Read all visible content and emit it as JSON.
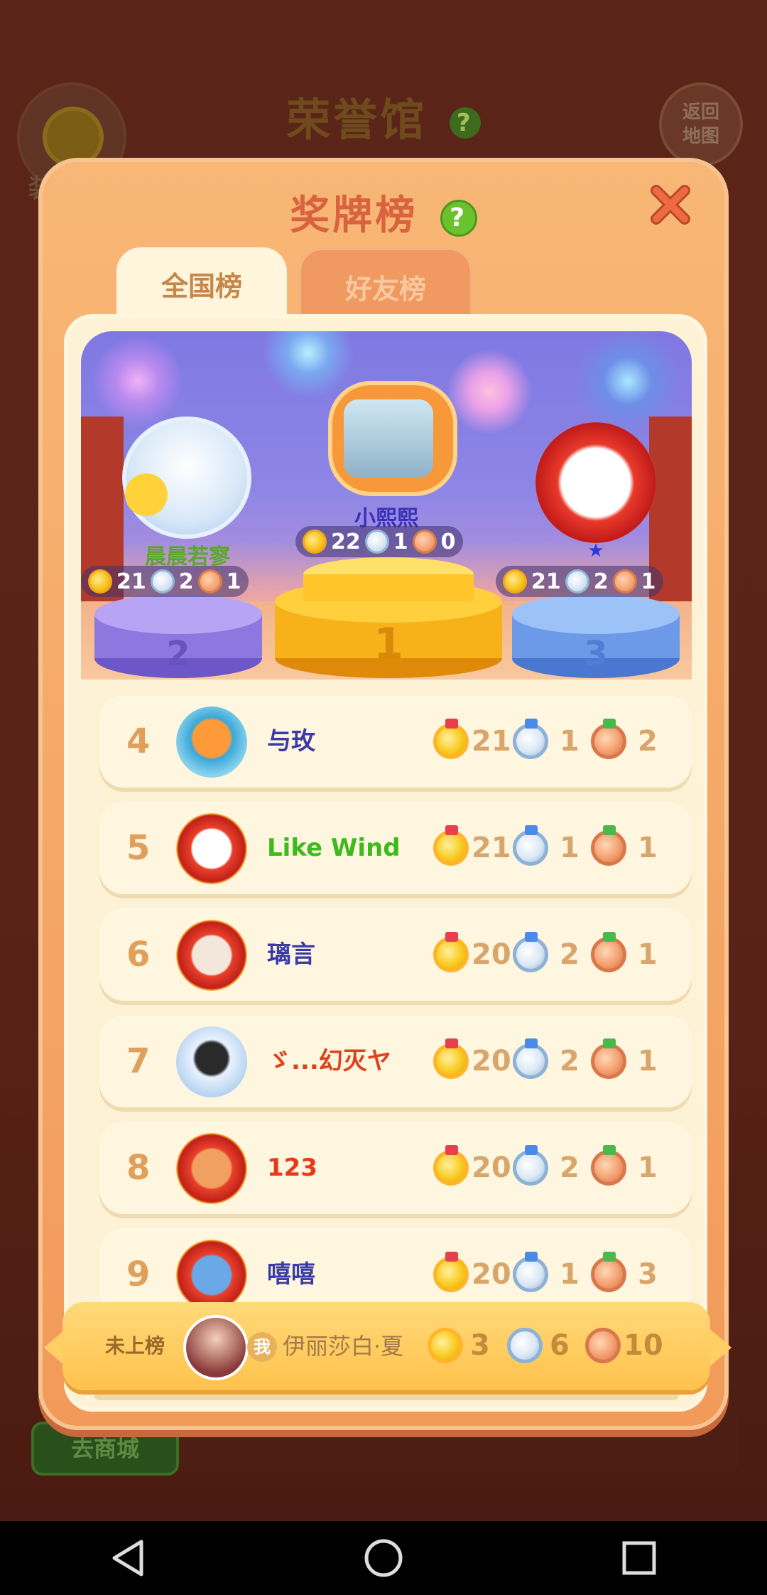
{
  "background": {
    "title": "荣誉馆",
    "help_icon": "?",
    "left_label": "装",
    "back_to_map": [
      "返回",
      "地图"
    ],
    "shop_button": "去商城"
  },
  "modal": {
    "title": "奖牌榜",
    "help_icon": "?",
    "tabs": [
      {
        "label": "全国榜",
        "active": true
      },
      {
        "label": "好友榜",
        "active": false
      }
    ]
  },
  "podium": [
    {
      "rank": 1,
      "name": "小熙熙",
      "gold": 22,
      "silver": 1,
      "bronze": 0,
      "name_color": "#3a2fb8"
    },
    {
      "rank": 2,
      "name": "晨晨若寥",
      "gold": 21,
      "silver": 2,
      "bronze": 1,
      "name_color": "#5aa82a"
    },
    {
      "rank": 3,
      "name": "★",
      "gold": 21,
      "silver": 2,
      "bronze": 1,
      "name_color": "#2a3ad8"
    }
  ],
  "pedestal_numbers": [
    "2",
    "1",
    "3"
  ],
  "rows": [
    {
      "rank": "4",
      "name": "与玫",
      "gold": "21",
      "silver": "1",
      "bronze": "2",
      "name_color": "#3a3aa8"
    },
    {
      "rank": "5",
      "name": "Like Wind",
      "gold": "21",
      "silver": "1",
      "bronze": "1",
      "name_color": "#3dbb1c"
    },
    {
      "rank": "6",
      "name": "璃言",
      "gold": "20",
      "silver": "2",
      "bronze": "1",
      "name_color": "#3a3aa8"
    },
    {
      "rank": "7",
      "name": "ゞ...幻灭ヤ",
      "gold": "20",
      "silver": "2",
      "bronze": "1",
      "name_color": "#e0401a"
    },
    {
      "rank": "8",
      "name": "123",
      "gold": "20",
      "silver": "2",
      "bronze": "1",
      "name_color": "#e83a1a"
    },
    {
      "rank": "9",
      "name": "嘻嘻",
      "gold": "20",
      "silver": "1",
      "bronze": "3",
      "name_color": "#3a3aa8"
    }
  ],
  "my_rank": {
    "status": "未上榜",
    "badge": "我",
    "name": "伊丽莎白·夏",
    "gold": "3",
    "silver": "6",
    "bronze": "10"
  },
  "colors": {
    "modal_bg": "#f6a866",
    "inner_bg": "#fdf2d6",
    "title_color": "#d9623f",
    "accent_green": "#6cc22c"
  }
}
